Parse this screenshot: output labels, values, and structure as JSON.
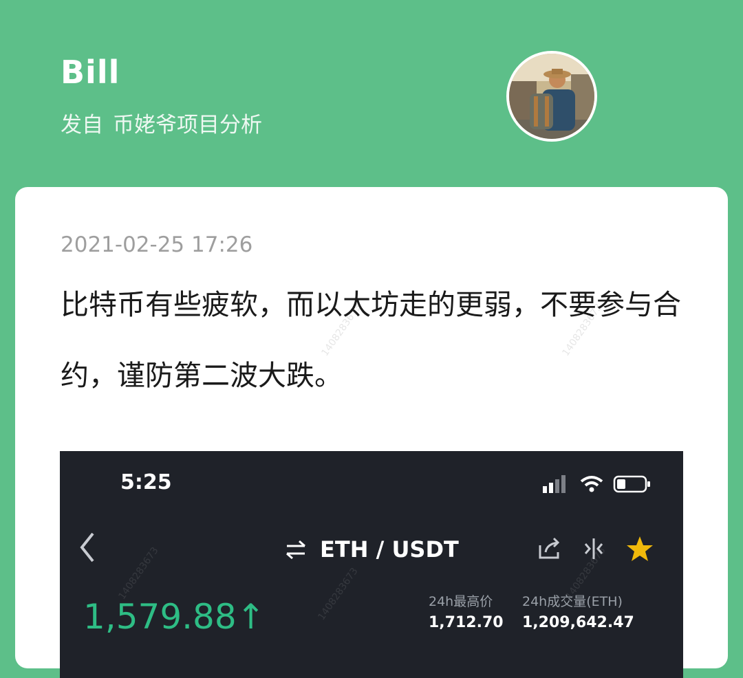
{
  "header": {
    "author_name": "Bill",
    "source_prefix": "发自",
    "source_name": "币姥爷项目分析",
    "avatar_icon": "avatar-photo"
  },
  "post": {
    "timestamp": "2021-02-25 17:26",
    "text": "比特币有些疲软，而以太坊走的更弱，不要参与合约，谨防第二波大跌。",
    "watermark": "1408283673"
  },
  "screenshot": {
    "status_time": "5:25",
    "pair_label": "ETH / USDT",
    "price": "1,579.88",
    "price_arrow": "↑",
    "high_label": "24h最高价",
    "high_value": "1,712.70",
    "volume_label": "24h成交量(ETH)",
    "volume_value": "1,209,642.47",
    "icons": [
      "back-icon",
      "swap-icon",
      "share-icon",
      "kline-icon",
      "star-icon",
      "signal-icon",
      "wifi-icon",
      "battery-icon"
    ],
    "colors": {
      "background": "#1f2229",
      "price_up": "#2ebd85",
      "star": "#f0b90b"
    }
  },
  "colors": {
    "brand_green": "#5dbf89",
    "card": "#ffffff"
  }
}
